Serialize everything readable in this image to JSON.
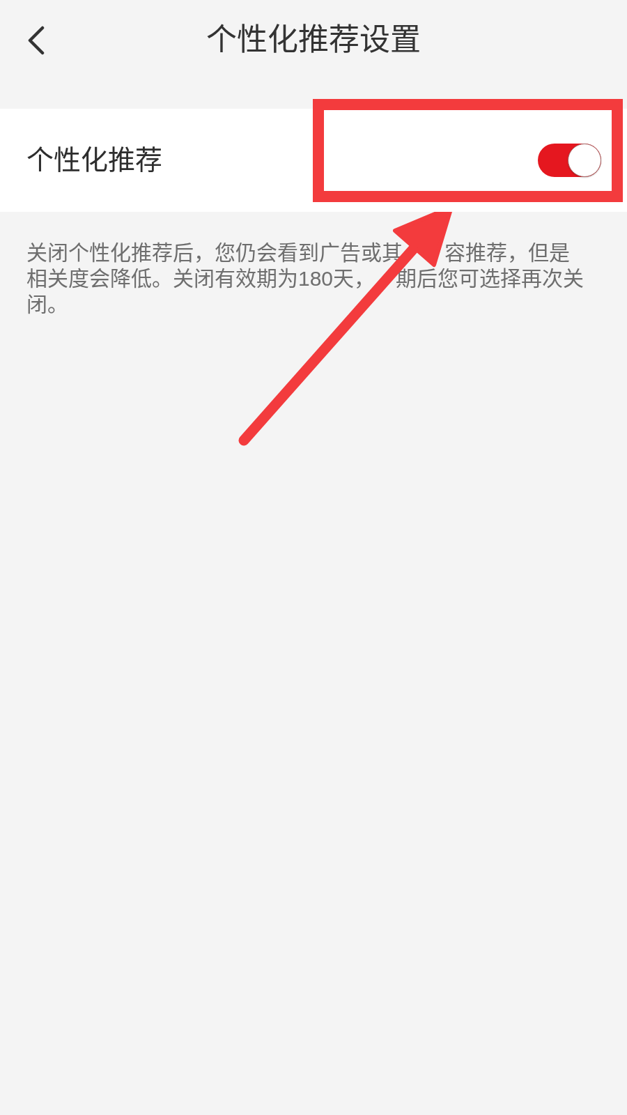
{
  "header": {
    "title": "个性化推荐设置"
  },
  "settings": [
    {
      "label": "个性化推荐",
      "on": true,
      "highlighted": true
    }
  ],
  "description": {
    "lines": [
      [
        "关闭个性化推荐后，您仍会看到广告或其",
        "容推荐，但是"
      ],
      [
        "相关度会降低。关闭有效期为180天，",
        "期后您可选择再次关"
      ],
      [
        "闭。"
      ]
    ]
  }
}
